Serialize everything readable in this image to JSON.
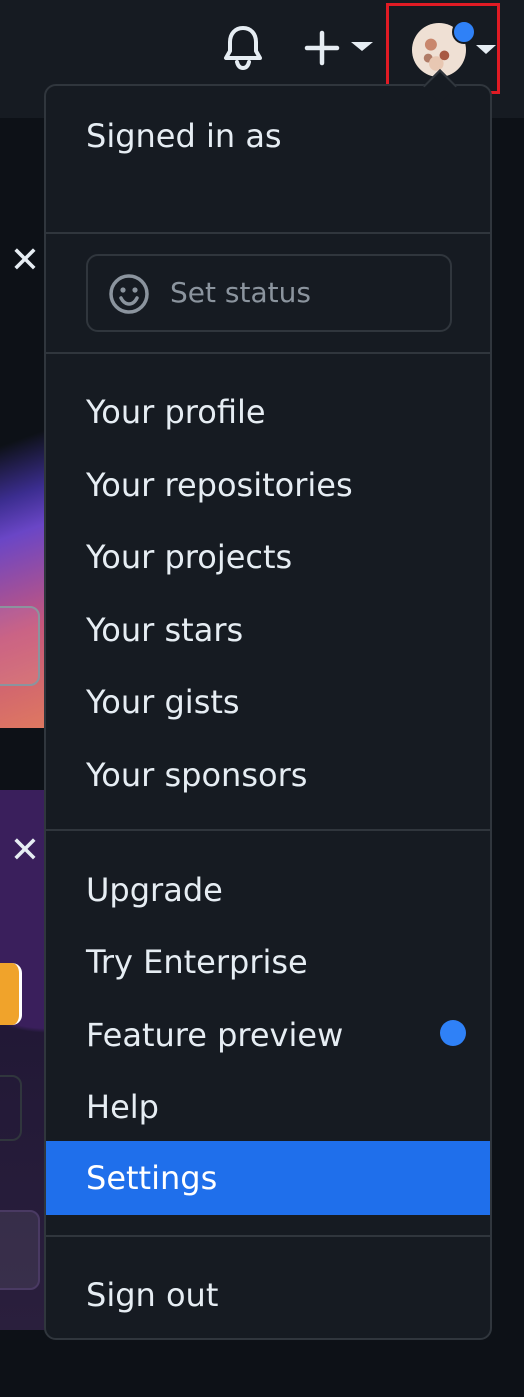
{
  "header": {
    "notifications_icon": "bell-icon",
    "create_icon": "plus-icon",
    "avatar_icon": "avatar",
    "highlight_color": "#e01b24"
  },
  "menu": {
    "signed_in_label": "Signed in as",
    "set_status_placeholder": "Set status",
    "items_group1": [
      "Your profile",
      "Your repositories",
      "Your projects",
      "Your stars",
      "Your gists",
      "Your sponsors"
    ],
    "items_group2": [
      "Upgrade",
      "Try Enterprise",
      "Feature preview",
      "Help",
      "Settings"
    ],
    "sign_out": "Sign out",
    "selected_item": "Settings",
    "accent_color": "#1f6feb"
  }
}
